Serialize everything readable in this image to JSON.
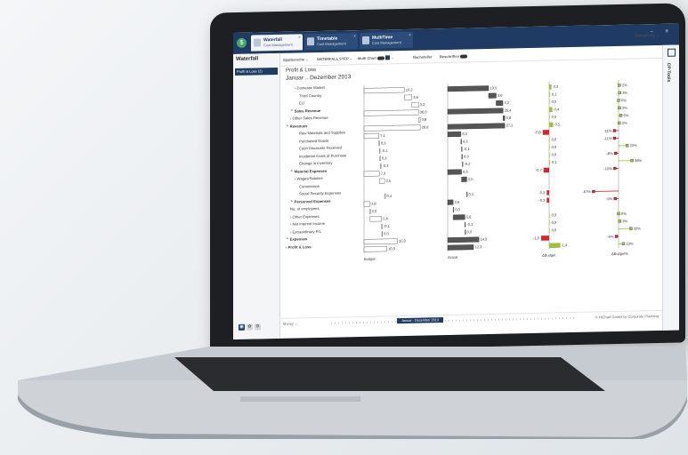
{
  "app": {
    "tabs": [
      {
        "title": "Waterfall",
        "subtitle": "Cost Management",
        "active": true
      },
      {
        "title": "Timetable",
        "subtitle": "Cost Management",
        "active": false
      },
      {
        "title": "MultiTime",
        "subtitle": "Cost Management",
        "active": false
      }
    ],
    "window_controls": "– ≡",
    "sidebar_title": "Waterfall",
    "sidebar_item": "Profit & Loss (2)",
    "sidebar_buttons": [
      "▣",
      "✿",
      "⚙"
    ],
    "right_panel_label": "CP-Tools",
    "toolbar": {
      "item1": "Spaltenreihe",
      "item2": "WATERFALL STEP",
      "item3": "Multi Chart",
      "item4": "Nachsteller",
      "item5": "Beschriften",
      "dropdown": "Darstellung"
    },
    "footer": {
      "money": "Money",
      "period": "Januar - Dezember 2013",
      "credit": "© HiChart GmbH by Corporate Planning"
    }
  },
  "report": {
    "title": "Profit & Loss",
    "subtitle": "Januar .. Dezember 2013",
    "rows": [
      {
        "label": "› Domestic Market",
        "bold": false,
        "indent": 2
      },
      {
        "label": "Third Country",
        "bold": false,
        "indent": 3
      },
      {
        "label": "EU",
        "bold": false,
        "indent": 3
      },
      {
        "label": "⌃ Sales Revenue",
        "bold": true,
        "indent": 1
      },
      {
        "label": "› Other Sales Revenue",
        "bold": false,
        "indent": 1
      },
      {
        "label": "⌃ Revenues",
        "bold": true,
        "indent": 0
      },
      {
        "label": "Raw Materials and Supplies",
        "bold": false,
        "indent": 3
      },
      {
        "label": "Purchased Goods",
        "bold": false,
        "indent": 3
      },
      {
        "label": "Cash Discounts Received",
        "bold": false,
        "indent": 3
      },
      {
        "label": "Incidental Costs of Purchase",
        "bold": false,
        "indent": 3
      },
      {
        "label": "Change in Inventory",
        "bold": false,
        "indent": 3
      },
      {
        "label": "⌃ Material Expenses",
        "bold": true,
        "indent": 1
      },
      {
        "label": "› Wages/Salaries",
        "bold": false,
        "indent": 2
      },
      {
        "label": "Commission",
        "bold": false,
        "indent": 3
      },
      {
        "label": "Social Security Expenses",
        "bold": false,
        "indent": 3
      },
      {
        "label": "⌃ Personnel Expenses",
        "bold": true,
        "indent": 1
      },
      {
        "label": "No. of employees",
        "bold": false,
        "indent": 1
      },
      {
        "label": "› Other Expenses",
        "bold": false,
        "indent": 1
      },
      {
        "label": "› Net Interest Income",
        "bold": false,
        "indent": 1
      },
      {
        "label": "› Extraordinary P/L",
        "bold": false,
        "indent": 1
      },
      {
        "label": "⌃ Expenses",
        "bold": true,
        "indent": 0
      },
      {
        "label": "› Profit & Loss",
        "bold": true,
        "indent": 0
      }
    ]
  },
  "chart_data": [
    {
      "type": "bar",
      "title": "",
      "xlabel": "Budget",
      "values": [
        "19,2",
        "3,6",
        "3,2",
        "26,0",
        "0,8",
        "26,8",
        "7,1",
        "0,3",
        "-0,1",
        "0,3",
        "-0,3",
        "7,3",
        "2,5",
        "",
        "0,4",
        "2,8",
        "0,0",
        "5,6",
        "-0,1",
        "0,0",
        "15,9",
        "10,9"
      ]
    },
    {
      "type": "bar",
      "title": "",
      "xlabel": "Actual",
      "values": [
        "19,5",
        "3,6",
        "3,2",
        "26,4",
        "0,8",
        "27,2",
        "6,3",
        "0,3",
        "-0,1",
        "0,3",
        "-0,2",
        "6,6",
        "2,5",
        "",
        "0,1",
        "2,6",
        "0,0",
        "5,6",
        "-0,1",
        "0,0",
        "14,9",
        "12,3"
      ]
    },
    {
      "type": "bar",
      "title": "",
      "xlabel": "ΔBudget",
      "values": [
        "0,3",
        "0,1",
        "0,0",
        "0,4",
        "0,0",
        "0,5",
        "-0,8",
        "0,0",
        "0,0",
        "0,0",
        "0,1",
        "-0,7",
        "",
        "",
        "-0,3",
        "-0,3",
        "",
        "0,0",
        "0,0",
        "0,0",
        "-1,0",
        "1,4"
      ]
    },
    {
      "type": "bar",
      "title": "",
      "xlabel": "ΔBudget%",
      "values": [
        "2%",
        "3%",
        "0%",
        "2%",
        "6%",
        "2%",
        "-11%",
        "-11%",
        "23%",
        "-8%",
        "36%",
        "-10%",
        "",
        "",
        "-67%",
        "-9%",
        "",
        "0%",
        "3%",
        "33%",
        "-6%",
        "13%"
      ]
    }
  ],
  "colors": {
    "topbar": "#1f3b63",
    "green": "#9cc23c",
    "red": "#d9252b",
    "bar": "#555555"
  }
}
